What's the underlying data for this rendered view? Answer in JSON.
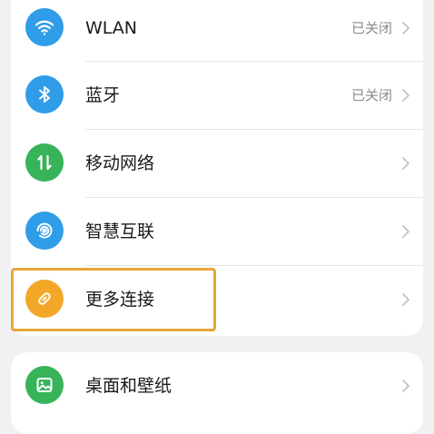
{
  "colors": {
    "page_background": "#f1f1f3",
    "card_background": "#ffffff",
    "highlight_border": "#e7a63a",
    "wlan_icon": "#2f9de8",
    "bluetooth_icon": "#2f9de8",
    "mobile_network_icon": "#37b35a",
    "smart_connect_icon": "#2f9de8",
    "more_connections_icon": "#f2a728",
    "wallpaper_icon": "#37b35a"
  },
  "settings": {
    "network_group": [
      {
        "label": "WLAN",
        "status": "已关闭",
        "icon": "wifi-icon"
      },
      {
        "label": "蓝牙",
        "status": "已关闭",
        "icon": "bluetooth-icon"
      },
      {
        "label": "移动网络",
        "status": "",
        "icon": "mobile-network-icon"
      },
      {
        "label": "智慧互联",
        "status": "",
        "icon": "smart-connect-icon"
      },
      {
        "label": "更多连接",
        "status": "",
        "icon": "link-icon"
      }
    ],
    "display_group": [
      {
        "label": "桌面和壁纸",
        "status": "",
        "icon": "wallpaper-icon"
      }
    ]
  }
}
